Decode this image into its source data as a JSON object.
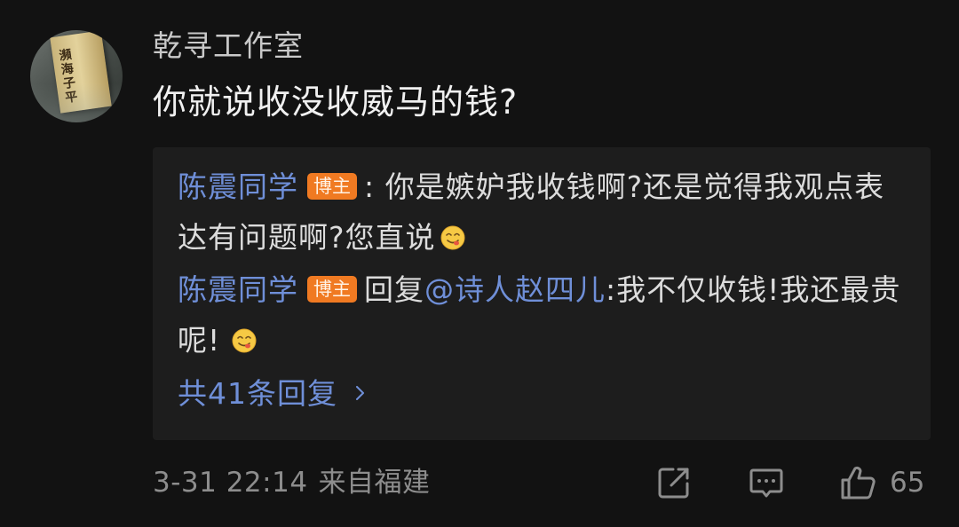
{
  "comment": {
    "avatar_text": "瀕海子平",
    "username": "乾寻工作室",
    "text": "你就说收没收威马的钱?"
  },
  "replies": [
    {
      "name": "陈震同学",
      "badge": "博主",
      "separator": ":",
      "text": " 你是嫉妒我收钱啊?还是觉得我观点表达有问题啊?您直说",
      "emoji": "yum-face-emoji"
    },
    {
      "name": "陈震同学",
      "badge": "博主",
      "prefix": "回复",
      "mention": "@诗人赵四儿",
      "text": ":我不仅收钱!我还最贵呢!",
      "emoji": "yum-face-emoji"
    }
  ],
  "more_replies": {
    "label": "共41条回复"
  },
  "footer": {
    "timestamp": "3-31 22:14",
    "location": "来自福建",
    "like_count": "65"
  },
  "icons": {
    "share": "share-icon",
    "comment": "comment-icon",
    "like": "thumbs-up-icon",
    "chevron": "chevron-right-icon"
  },
  "colors": {
    "background": "#121212",
    "reply_box": "#1d1d1d",
    "link_blue": "#6f8fd8",
    "badge_orange": "#f07a22",
    "muted": "#8d8d8d"
  }
}
